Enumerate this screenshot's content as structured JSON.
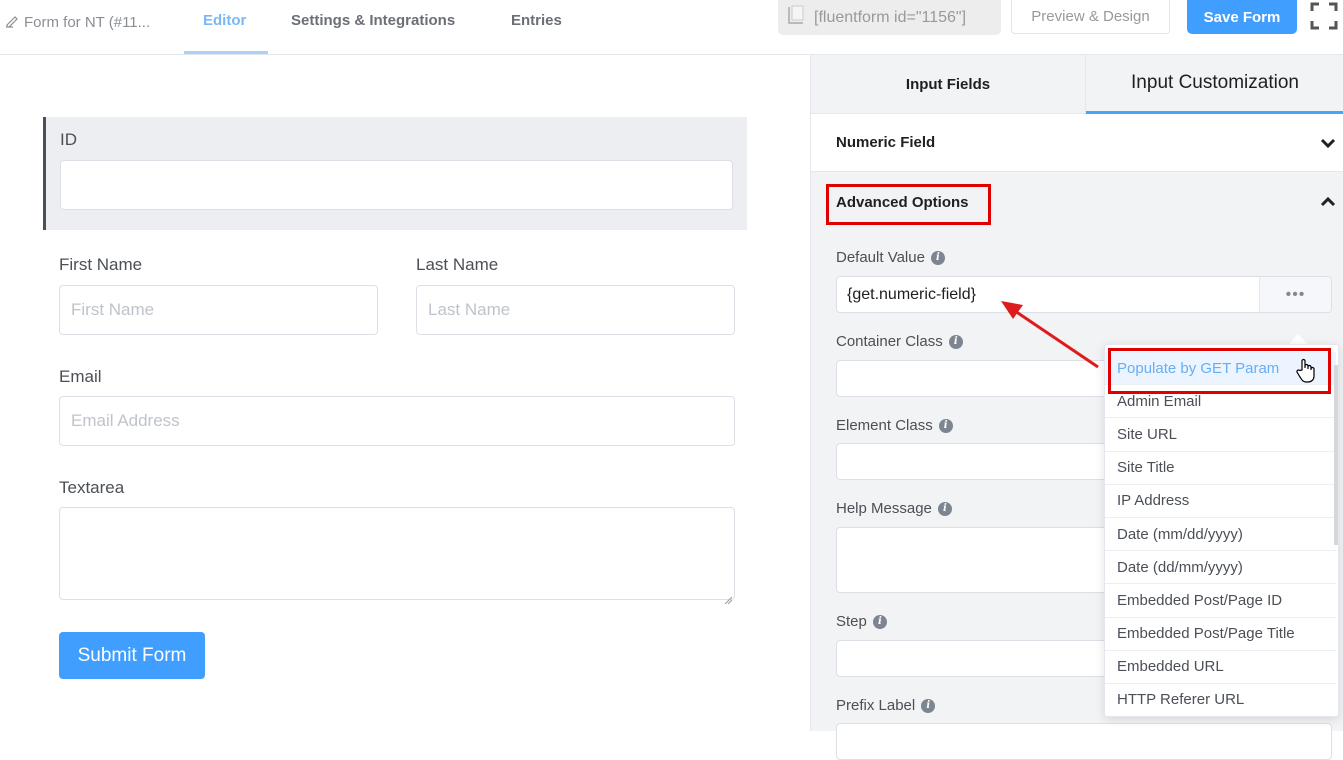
{
  "header": {
    "form_title": "Form for NT (#11...",
    "tabs": [
      {
        "label": "Editor",
        "active": true
      },
      {
        "label": "Settings & Integrations",
        "active": false
      },
      {
        "label": "Entries",
        "active": false
      }
    ],
    "shortcode": "[fluentform id=\"1156\"]",
    "preview_label": "Preview & Design",
    "save_label": "Save Form"
  },
  "form": {
    "id_label": "ID",
    "first_name_label": "First Name",
    "first_name_placeholder": "First Name",
    "last_name_label": "Last Name",
    "last_name_placeholder": "Last Name",
    "email_label": "Email",
    "email_placeholder": "Email Address",
    "textarea_label": "Textarea",
    "submit_label": "Submit Form"
  },
  "panel": {
    "tabs": [
      {
        "label": "Input Fields",
        "active": false
      },
      {
        "label": "Input Customization",
        "active": true
      }
    ],
    "sections": [
      {
        "label": "Numeric Field",
        "expanded": false
      },
      {
        "label": "Advanced Options",
        "expanded": true
      }
    ],
    "fields": {
      "default_value_label": "Default Value",
      "default_value": "{get.numeric-field}",
      "dots_label": "•••",
      "container_class_label": "Container Class",
      "element_class_label": "Element Class",
      "help_message_label": "Help Message",
      "step_label": "Step",
      "prefix_label_label": "Prefix Label"
    }
  },
  "dropdown": {
    "items": [
      "Populate by GET Param",
      "Admin Email",
      "Site URL",
      "Site Title",
      "IP Address",
      "Date (mm/dd/yyyy)",
      "Date (dd/mm/yyyy)",
      "Embedded Post/Page ID",
      "Embedded Post/Page Title",
      "Embedded URL",
      "HTTP Referer URL"
    ],
    "hovered": "Populate by GET Param"
  },
  "colors": {
    "accent": "#409eff",
    "annotation": "#e00000"
  }
}
